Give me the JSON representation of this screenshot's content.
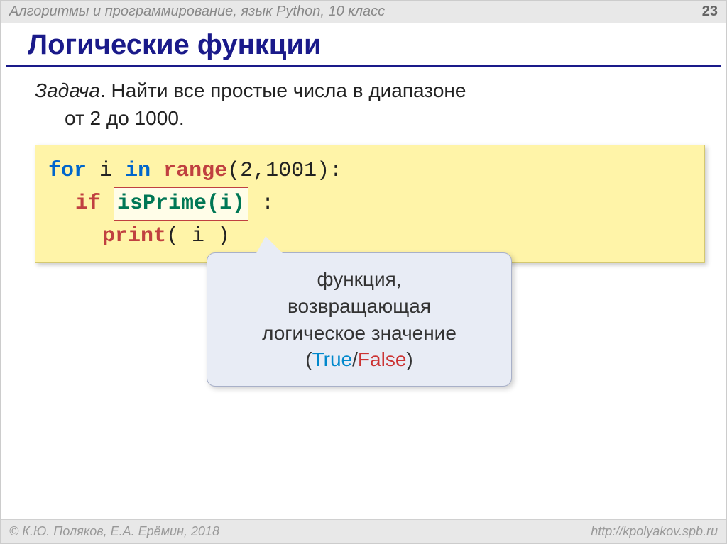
{
  "header": {
    "title": "Алгоритмы и программирование, язык Python, 10 класс",
    "page_number": "23"
  },
  "title": "Логические функции",
  "task": {
    "label": "Задача",
    "line1": ". Найти все простые числа в диапазоне",
    "line2": "от 2 до 1000."
  },
  "code": {
    "for": "for",
    "i1": "i",
    "in": "in",
    "range": "range",
    "args": "(2,1001):",
    "if": "if",
    "isprime": "isPrime(i)",
    "colon": ":",
    "print": "print",
    "printargs": "( i )"
  },
  "callout": {
    "line1": "функция,",
    "line2": "возвращающая",
    "line3": "логическое значение",
    "true": "True",
    "slash": "/",
    "false": "False",
    "lparen": "(",
    "rparen": ")"
  },
  "footer": {
    "left": "© К.Ю. Поляков, Е.А. Ерёмин, 2018",
    "right": "http://kpolyakov.spb.ru"
  }
}
